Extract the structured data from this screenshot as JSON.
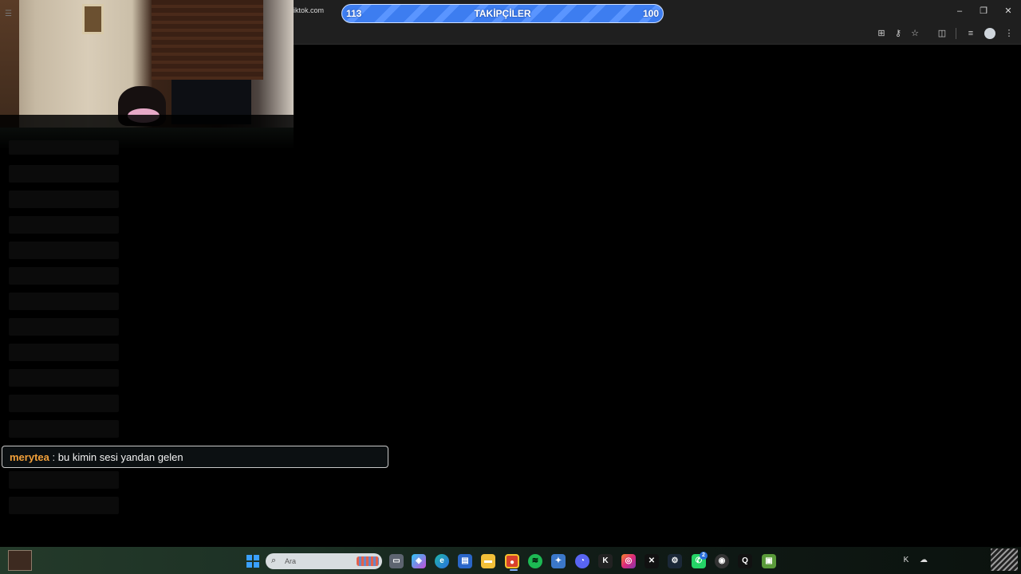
{
  "browser": {
    "url_fragment": "iktok.com",
    "window_controls": [
      "minimize-icon",
      "restore-icon",
      "close-icon"
    ],
    "toolbar_icons": [
      "translate-icon",
      "password-key-icon",
      "star-icon",
      "extensions-icon",
      "media-queue-icon",
      "profile-avatar-icon",
      "menu-kebab-icon"
    ]
  },
  "followers_goal": {
    "current": "113",
    "label": "TAKİPÇİLER",
    "target": "100",
    "progress": 1.0,
    "color": "#3d7df0"
  },
  "chat": {
    "message": {
      "username": "merytea",
      "separator": ":",
      "text": "bu kimin sesi yandan gelen",
      "username_color": "#f2a03a"
    }
  },
  "taskbar": {
    "search_placeholder": "Ara",
    "apps": [
      "file-explorer-icon",
      "copilot-icon",
      "edge-icon",
      "store-icon",
      "folder-icon",
      "chrome-icon",
      "spotify-icon",
      "network-icon",
      "discord-icon",
      "kick-icon",
      "instagram-icon",
      "capcut-icon",
      "steam-icon",
      "whatsapp-icon",
      "obs-icon",
      "search-app-icon",
      "minecraft-icon"
    ],
    "whatsapp_badge": "2",
    "tray_icons": [
      "kick-tray-icon",
      "cloud-tray-icon"
    ]
  }
}
